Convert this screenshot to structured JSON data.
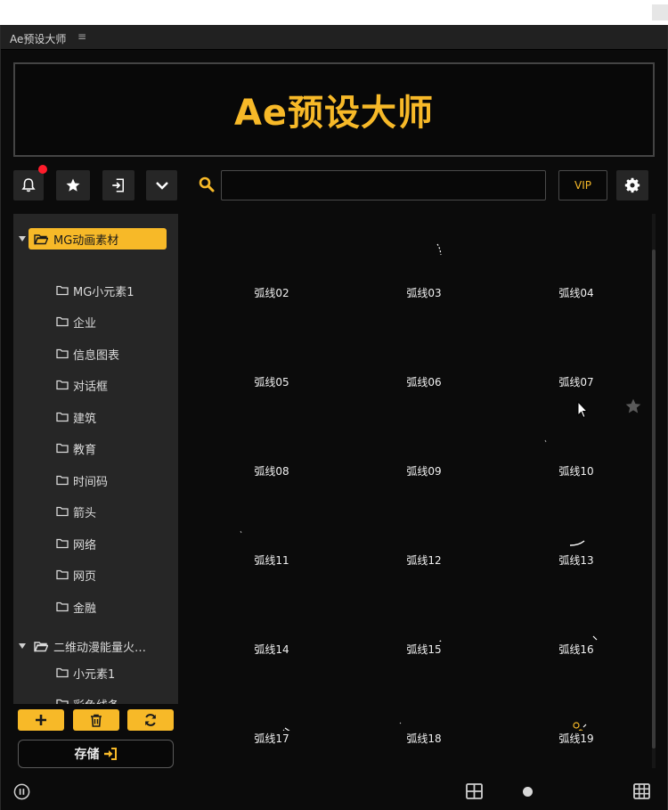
{
  "window": {
    "tab_title": "Ae预设大师",
    "tab_menu": "≡"
  },
  "banner": {
    "logo_text": "Ae预设大师"
  },
  "toolbar": {
    "search_placeholder": "",
    "vip_label": "VIP"
  },
  "sidebar": {
    "categories": [
      {
        "label": "MG动画素材",
        "expanded": true,
        "active": true,
        "children": [
          "MG小元素1",
          "企业",
          "信息图表",
          "对话框",
          "建筑",
          "教育",
          "时间码",
          "箭头",
          "网络",
          "网页",
          "金融"
        ]
      },
      {
        "label": "二维动漫能量火…",
        "expanded": true,
        "active": false,
        "children": [
          "小元素1",
          "彩色线条"
        ]
      }
    ]
  },
  "actions": {
    "save_label": "存储"
  },
  "grid": {
    "items": [
      "弧线02",
      "弧线03",
      "弧线04",
      "弧线05",
      "弧线06",
      "弧线07",
      "弧线08",
      "弧线09",
      "弧线10",
      "弧线11",
      "弧线12",
      "弧线13",
      "弧线14",
      "弧线15",
      "弧线16",
      "弧线17",
      "弧线18",
      "弧线19"
    ]
  },
  "colors": {
    "accent": "#f7b928",
    "notification": "#ff1c2b",
    "background": "#0b0b0b",
    "panel": "#262626"
  },
  "icons": [
    "bell-icon",
    "star-icon",
    "import-icon",
    "chevron-down-icon",
    "search-icon",
    "gear-icon",
    "folder-icon",
    "plus-icon",
    "trash-icon",
    "refresh-icon",
    "sign-in-icon",
    "pause-icon",
    "grid-icon"
  ]
}
